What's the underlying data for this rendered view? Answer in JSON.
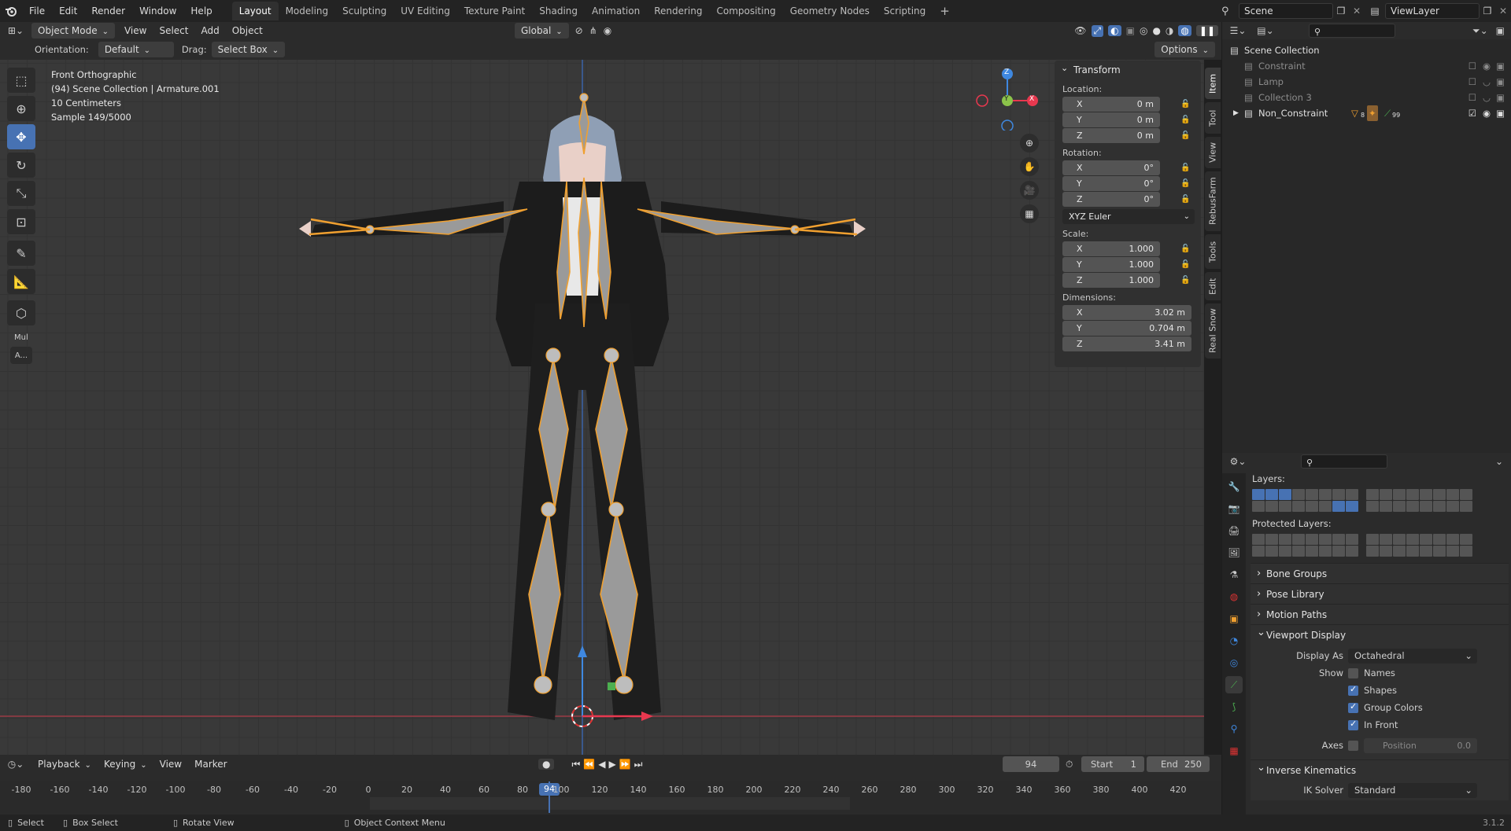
{
  "topbar": {
    "menus": [
      "File",
      "Edit",
      "Render",
      "Window",
      "Help"
    ],
    "workspaces": [
      "Layout",
      "Modeling",
      "Sculpting",
      "UV Editing",
      "Texture Paint",
      "Shading",
      "Animation",
      "Rendering",
      "Compositing",
      "Geometry Nodes",
      "Scripting"
    ],
    "active_workspace": "Layout",
    "add_workspace": "+",
    "scene": "Scene",
    "view_layer": "ViewLayer"
  },
  "viewport_header": {
    "mode": "Object Mode",
    "menus": [
      "View",
      "Select",
      "Add",
      "Object"
    ],
    "transform_orientation": "Global",
    "orientation_label": "Orientation:",
    "orientation_value": "Default",
    "drag_label": "Drag:",
    "drag_value": "Select Box",
    "options": "Options"
  },
  "viewport_info": {
    "line1": "Front Orthographic",
    "line2": "(94) Scene Collection | Armature.001",
    "line3": "10 Centimeters",
    "line4": "Sample 149/5000"
  },
  "gizmo": {
    "z": "Z",
    "y": "Y",
    "x": "X"
  },
  "toolbar_extra": {
    "mul": "Mul",
    "a": "A..."
  },
  "npanel": {
    "title": "Transform",
    "location_label": "Location:",
    "location": [
      {
        "axis": "X",
        "value": "0 m"
      },
      {
        "axis": "Y",
        "value": "0 m"
      },
      {
        "axis": "Z",
        "value": "0 m"
      }
    ],
    "rotation_label": "Rotation:",
    "rotation": [
      {
        "axis": "X",
        "value": "0°"
      },
      {
        "axis": "Y",
        "value": "0°"
      },
      {
        "axis": "Z",
        "value": "0°"
      }
    ],
    "rotation_mode": "XYZ Euler",
    "scale_label": "Scale:",
    "scale": [
      {
        "axis": "X",
        "value": "1.000"
      },
      {
        "axis": "Y",
        "value": "1.000"
      },
      {
        "axis": "Z",
        "value": "1.000"
      }
    ],
    "dimensions_label": "Dimensions:",
    "dimensions": [
      {
        "axis": "X",
        "value": "3.02 m"
      },
      {
        "axis": "Y",
        "value": "0.704 m"
      },
      {
        "axis": "Z",
        "value": "3.41 m"
      }
    ]
  },
  "sidetabs": [
    "Item",
    "Tool",
    "View",
    "RebusFarm",
    "Tools",
    "Edit",
    "Real Snow"
  ],
  "outliner": {
    "root": "Scene Collection",
    "items": [
      "Constraint",
      "Lamp",
      "Collection 3",
      "Non_Constraint"
    ],
    "badge1": "8",
    "badge2": "99"
  },
  "properties": {
    "layers_label": "Layers:",
    "protected_label": "Protected Layers:",
    "sections": [
      "Bone Groups",
      "Pose Library",
      "Motion Paths"
    ],
    "viewport_display": "Viewport Display",
    "display_as_label": "Display As",
    "display_as": "Octahedral",
    "show_label": "Show",
    "show_items": [
      {
        "label": "Names",
        "checked": false
      },
      {
        "label": "Shapes",
        "checked": true
      },
      {
        "label": "Group Colors",
        "checked": true
      },
      {
        "label": "In Front",
        "checked": true
      }
    ],
    "axes_label": "Axes",
    "axes_position": "Position",
    "axes_value": "0.0",
    "ik_section": "Inverse Kinematics",
    "ik_solver_label": "IK Solver",
    "ik_solver": "Standard"
  },
  "timeline": {
    "menus": [
      "Playback",
      "Keying",
      "View",
      "Marker"
    ],
    "current_frame": "94",
    "start_label": "Start",
    "start": "1",
    "end_label": "End",
    "end": "250",
    "ticks": [
      "-180",
      "-160",
      "-140",
      "-120",
      "-100",
      "-80",
      "-60",
      "-40",
      "-20",
      "0",
      "20",
      "40",
      "60",
      "80",
      "100",
      "120",
      "140",
      "160",
      "180",
      "200",
      "220",
      "240",
      "260",
      "280",
      "300",
      "320",
      "340",
      "360",
      "380",
      "400",
      "420"
    ],
    "playhead": "94"
  },
  "statusbar": {
    "select": "Select",
    "box_select": "Box Select",
    "rotate_view": "Rotate View",
    "context_menu": "Object Context Menu",
    "version": "3.1.2"
  },
  "colors": {
    "accent": "#4772b3",
    "selection": "#f0a030",
    "x_axis": "#e8384f",
    "y_axis": "#8bc34a",
    "z_axis": "#3f88e0"
  }
}
